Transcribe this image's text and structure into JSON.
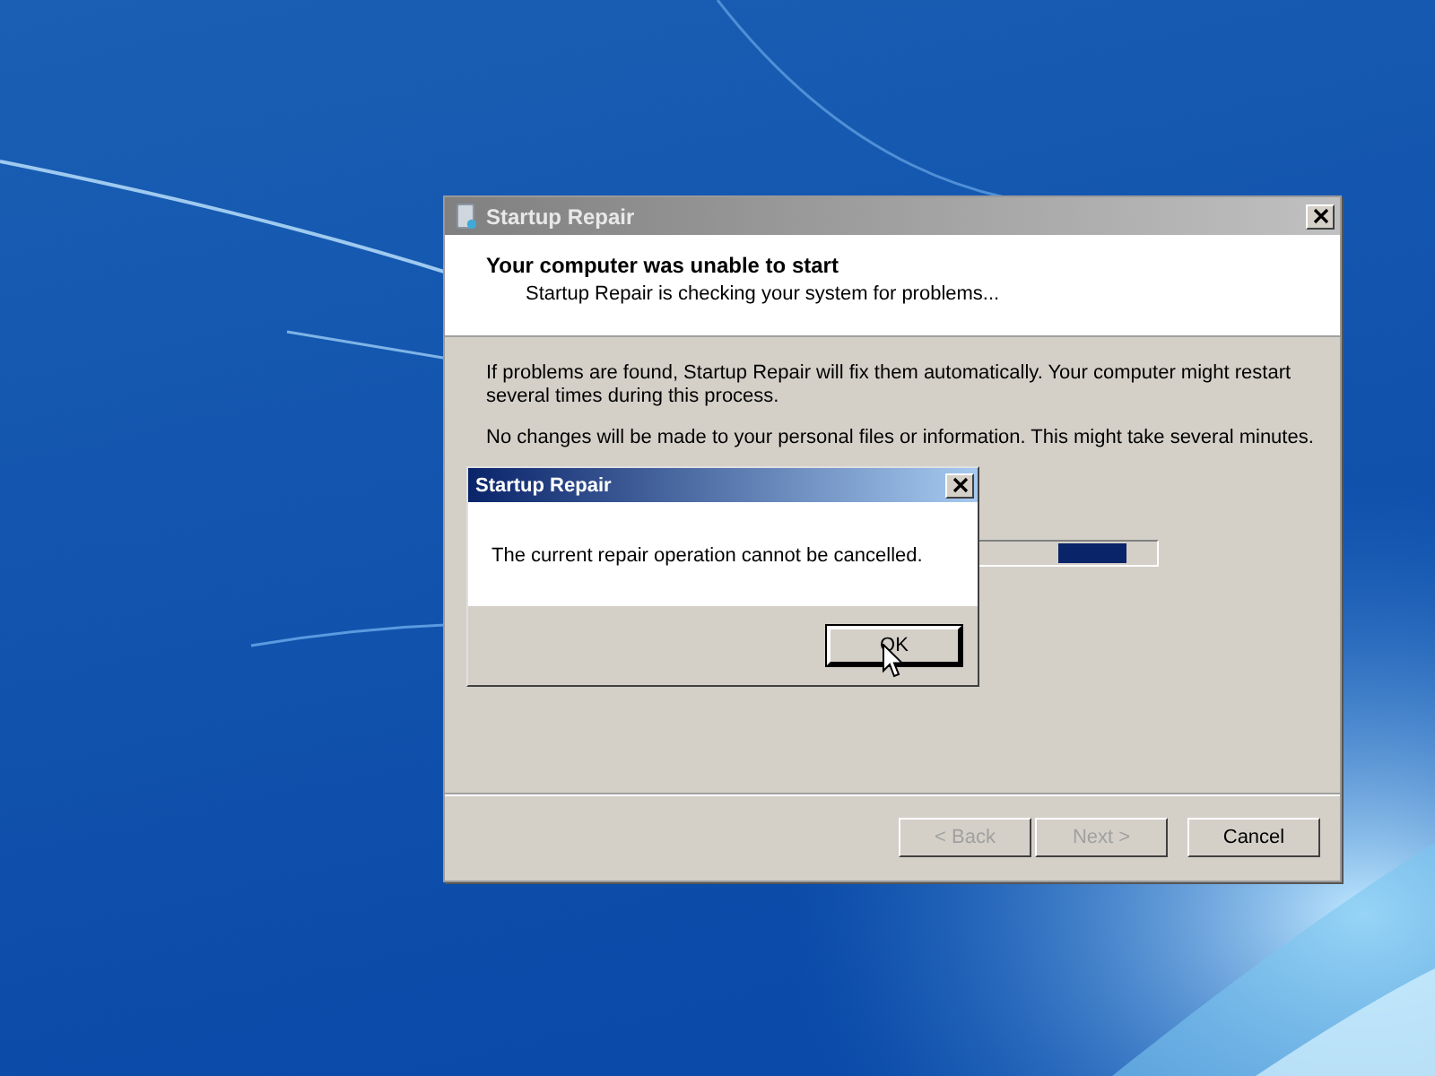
{
  "window": {
    "title": "Startup Repair",
    "heading": "Your computer was unable to start",
    "subheading": "Startup Repair is checking your system for problems...",
    "paragraphs": [
      "If problems are found, Startup Repair will fix them automatically. Your computer might restart several times during this process.",
      "No changes will be made to your personal files or information. This might take several minutes."
    ],
    "progress": {
      "kind": "marquee",
      "level": 0.96
    },
    "buttons": [
      {
        "label": "< Back",
        "disabled": true
      },
      {
        "label": "Next >",
        "disabled": true
      },
      {
        "label": "Cancel",
        "disabled": false
      }
    ]
  },
  "dialog": {
    "title": "Startup Repair",
    "message": "The current repair operation cannot be cancelled.",
    "button": "OK"
  }
}
